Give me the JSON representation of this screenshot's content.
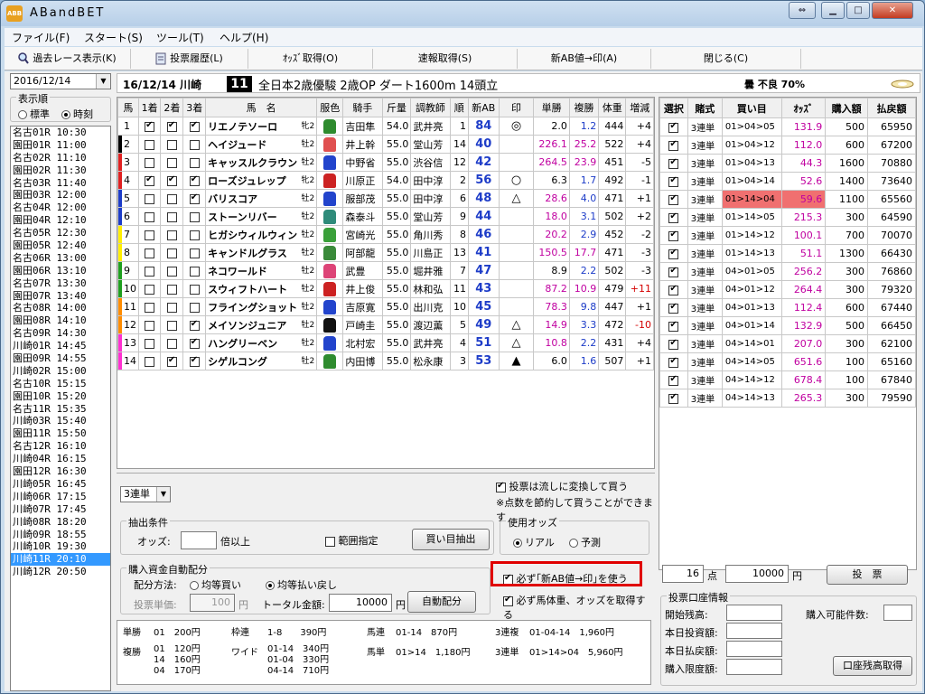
{
  "app": {
    "title": "ABandBET",
    "icon": "abb-app-icon"
  },
  "window_controls": [
    "restore-down-icon",
    "minimize-icon",
    "maximize-icon",
    "close-icon"
  ],
  "menu": [
    {
      "label": "ファイル(F)"
    },
    {
      "label": "スタート(S)"
    },
    {
      "label": "ツール(T)"
    },
    {
      "label": "ヘルプ(H)"
    }
  ],
  "toolbar": [
    {
      "label": "過去レース表示(K)",
      "icon": "search-icon"
    },
    {
      "label": "投票履歴(L)",
      "icon": "document-icon"
    },
    {
      "label": "ｵｯｽﾞ取得(O)"
    },
    {
      "label": "速報取得(S)"
    },
    {
      "label": "新AB値→印(A)"
    },
    {
      "label": "閉じる(C)"
    }
  ],
  "left": {
    "date": "2016/12/14",
    "sort_label": "表示順",
    "sort_options": [
      "標準",
      "時刻"
    ],
    "sort_selected": "時刻",
    "races": [
      "名古01R 10:30",
      "園田01R 11:00",
      "名古02R 11:10",
      "園田02R 11:30",
      "名古03R 11:40",
      "園田03R 12:00",
      "名古04R 12:00",
      "園田04R 12:10",
      "名古05R 12:30",
      "園田05R 12:40",
      "名古06R 13:00",
      "園田06R 13:10",
      "名古07R 13:30",
      "園田07R 13:40",
      "名古08R 14:00",
      "園田08R 14:10",
      "名古09R 14:30",
      "川崎01R 14:45",
      "園田09R 14:55",
      "川崎02R 15:00",
      "名古10R 15:15",
      "園田10R 15:20",
      "名古11R 15:35",
      "川崎03R 15:40",
      "園田11R 15:50",
      "名古12R 16:10",
      "川崎04R 16:15",
      "園田12R 16:30",
      "川崎05R 16:45",
      "川崎06R 17:15",
      "川崎07R 17:45",
      "川崎08R 18:20",
      "川崎09R 18:55",
      "川崎10R 19:30",
      "川崎11R 20:10",
      "川崎12R 20:50"
    ],
    "selected_race": "川崎11R 20:10"
  },
  "race_header": {
    "date_place": "16/12/14 川崎",
    "race_no": "11",
    "race_info": "全日本2歳優駿 2歳OP ダート1600m 14頭立",
    "weather": "曇 不良 70%",
    "weather_icon": "cloud-icon"
  },
  "table_headers": [
    "馬",
    "1着",
    "2着",
    "3着",
    "馬　名",
    "服色",
    "騎手",
    "斤量",
    "調教師",
    "順",
    "新AB",
    "印",
    "単勝",
    "複勝",
    "体重",
    "増減"
  ],
  "horses": [
    {
      "no": "1",
      "c1": true,
      "c2": true,
      "c3": true,
      "name": "リエノテソーロ",
      "sex": "牝2",
      "silk": "#2e8b2e",
      "jockey": "吉田隼",
      "weight": "54.0",
      "trainer": "武井亮",
      "rank": "1",
      "ab": "84",
      "mark": "◎",
      "win": "2.0",
      "place": "1.2",
      "body": "444",
      "diff": "+4",
      "frame": "#ffffff"
    },
    {
      "no": "2",
      "c1": false,
      "c2": false,
      "c3": false,
      "name": "ヘイジュード",
      "sex": "牡2",
      "silk": "#e05050",
      "jockey": "井上幹",
      "weight": "55.0",
      "trainer": "堂山芳",
      "rank": "14",
      "ab": "40",
      "mark": "",
      "win": "226.1",
      "place": "25.2",
      "body": "522",
      "diff": "+4",
      "frame": "#000000"
    },
    {
      "no": "3",
      "c1": false,
      "c2": false,
      "c3": false,
      "name": "キャッスルクラウン",
      "sex": "牡2",
      "silk": "#2244cc",
      "jockey": "中野省",
      "weight": "55.0",
      "trainer": "渋谷信",
      "rank": "12",
      "ab": "42",
      "mark": "",
      "win": "264.5",
      "place": "23.9",
      "body": "451",
      "diff": "-5",
      "frame": "#e02020"
    },
    {
      "no": "4",
      "c1": true,
      "c2": true,
      "c3": true,
      "name": "ローズジュレップ",
      "sex": "牝2",
      "silk": "#cc2222",
      "jockey": "川原正",
      "weight": "54.0",
      "trainer": "田中淳",
      "rank": "2",
      "ab": "56",
      "mark": "○",
      "win": "6.3",
      "place": "1.7",
      "body": "492",
      "diff": "-1",
      "frame": "#e02020"
    },
    {
      "no": "5",
      "c1": false,
      "c2": false,
      "c3": true,
      "name": "バリスコア",
      "sex": "牡2",
      "silk": "#2244cc",
      "jockey": "服部茂",
      "weight": "55.0",
      "trainer": "田中淳",
      "rank": "6",
      "ab": "48",
      "mark": "△",
      "win": "28.6",
      "place": "4.0",
      "body": "471",
      "diff": "+1",
      "frame": "#1d3cc8"
    },
    {
      "no": "6",
      "c1": false,
      "c2": false,
      "c3": false,
      "name": "ストーンリバー",
      "sex": "牡2",
      "silk": "#2e8b7a",
      "jockey": "森泰斗",
      "weight": "55.0",
      "trainer": "堂山芳",
      "rank": "9",
      "ab": "44",
      "mark": "",
      "win": "18.0",
      "place": "3.1",
      "body": "502",
      "diff": "+2",
      "frame": "#1d3cc8"
    },
    {
      "no": "7",
      "c1": false,
      "c2": false,
      "c3": false,
      "name": "ヒガシウィルウィン",
      "sex": "牡2",
      "silk": "#3aa03a",
      "jockey": "宮崎光",
      "weight": "55.0",
      "trainer": "角川秀",
      "rank": "8",
      "ab": "46",
      "mark": "",
      "win": "20.2",
      "place": "2.9",
      "body": "452",
      "diff": "-2",
      "frame": "#ffee00"
    },
    {
      "no": "8",
      "c1": false,
      "c2": false,
      "c3": false,
      "name": "キャンドルグラス",
      "sex": "牡2",
      "silk": "#3a8a3a",
      "jockey": "阿部龍",
      "weight": "55.0",
      "trainer": "川島正",
      "rank": "13",
      "ab": "41",
      "mark": "",
      "win": "150.5",
      "place": "17.7",
      "body": "471",
      "diff": "-3",
      "frame": "#ffee00"
    },
    {
      "no": "9",
      "c1": false,
      "c2": false,
      "c3": false,
      "name": "ネコワールド",
      "sex": "牡2",
      "silk": "#dd4477",
      "jockey": "武豊",
      "weight": "55.0",
      "trainer": "堀井雅",
      "rank": "7",
      "ab": "47",
      "mark": "",
      "win": "8.9",
      "place": "2.2",
      "body": "502",
      "diff": "-3",
      "frame": "#1fa01f"
    },
    {
      "no": "10",
      "c1": false,
      "c2": false,
      "c3": false,
      "name": "スウィフトハート",
      "sex": "牡2",
      "silk": "#cc2222",
      "jockey": "井上俊",
      "weight": "55.0",
      "trainer": "林和弘",
      "rank": "11",
      "ab": "43",
      "mark": "",
      "win": "87.2",
      "place": "10.9",
      "body": "479",
      "diff": "+11",
      "frame": "#1fa01f"
    },
    {
      "no": "11",
      "c1": false,
      "c2": false,
      "c3": false,
      "name": "フライングショット",
      "sex": "牡2",
      "silk": "#2244cc",
      "jockey": "吉原寛",
      "weight": "55.0",
      "trainer": "出川克",
      "rank": "10",
      "ab": "45",
      "mark": "",
      "win": "78.3",
      "place": "9.8",
      "body": "447",
      "diff": "+1",
      "frame": "#ff8c00"
    },
    {
      "no": "12",
      "c1": false,
      "c2": false,
      "c3": true,
      "name": "メイソンジュニア",
      "sex": "牡2",
      "silk": "#111111",
      "jockey": "戸崎圭",
      "weight": "55.0",
      "trainer": "渡辺薫",
      "rank": "5",
      "ab": "49",
      "mark": "△",
      "win": "14.9",
      "place": "3.3",
      "body": "472",
      "diff": "-10",
      "frame": "#ff8c00"
    },
    {
      "no": "13",
      "c1": false,
      "c2": false,
      "c3": true,
      "name": "ハングリーベン",
      "sex": "牡2",
      "silk": "#2244cc",
      "jockey": "北村宏",
      "weight": "55.0",
      "trainer": "武井亮",
      "rank": "4",
      "ab": "51",
      "mark": "△",
      "win": "10.8",
      "place": "2.2",
      "body": "431",
      "diff": "+4",
      "frame": "#ff30d0"
    },
    {
      "no": "14",
      "c1": false,
      "c2": true,
      "c3": true,
      "name": "シゲルコング",
      "sex": "牡2",
      "silk": "#2e8b2e",
      "jockey": "内田博",
      "weight": "55.0",
      "trainer": "松永康",
      "rank": "3",
      "ab": "53",
      "mark": "▲",
      "win": "6.0",
      "place": "1.6",
      "body": "507",
      "diff": "+1",
      "frame": "#ff30d0"
    }
  ],
  "bottom": {
    "bet_type": "3連単",
    "convert_check": "投票は流しに変換して買う",
    "convert_note": "※点数を節約して買うことができます",
    "extract": {
      "title": "抽出条件",
      "odds_label": "オッズ:",
      "odds_suffix": "倍以上",
      "range_label": "範囲指定",
      "button": "買い目抽出"
    },
    "odds_use": {
      "title": "使用オッズ",
      "options": [
        "リアル",
        "予測"
      ],
      "selected": "リアル"
    },
    "auto": {
      "title": "購入資金自動配分",
      "method_label": "配分方法:",
      "options": [
        "均等買い",
        "均等払い戻し"
      ],
      "selected": "均等払い戻し",
      "unit_label": "投票単価:",
      "unit_value": "100",
      "unit_suffix": "円",
      "total_label": "トータル金額:",
      "total_value": "10000",
      "total_suffix": "円",
      "button": "自動配分"
    },
    "opt1": "必ず｢新AB値→印｣を使う",
    "opt2": "必ず馬体重、オッズを取得する",
    "results": [
      {
        "label": "単勝",
        "value": "01　200円"
      },
      {
        "label": "複勝",
        "value": "01　120円\n14　160円\n04　170円"
      },
      {
        "label": "枠連",
        "value": "1-8　　390円"
      },
      {
        "label": "ワイド",
        "value": "01-14　340円\n01-04　330円\n04-14　710円"
      },
      {
        "label": "馬連",
        "value": "01-14　870円"
      },
      {
        "label": "馬単",
        "value": "01>14　1,180円"
      },
      {
        "label": "3連複",
        "value": "01-04-14　1,960円"
      },
      {
        "label": "3連単",
        "value": "01>14>04　5,960円"
      }
    ]
  },
  "bets": {
    "headers": [
      "選択",
      "賭式",
      "買い目",
      "ｵｯｽﾞ",
      "購入額",
      "払戻額"
    ],
    "rows": [
      {
        "type": "3連単",
        "combo": "01>04>05",
        "odds": "131.9",
        "amount": "500",
        "payout": "65950"
      },
      {
        "type": "3連単",
        "combo": "01>04>12",
        "odds": "112.0",
        "amount": "600",
        "payout": "67200"
      },
      {
        "type": "3連単",
        "combo": "01>04>13",
        "odds": "44.3",
        "amount": "1600",
        "payout": "70880"
      },
      {
        "type": "3連単",
        "combo": "01>04>14",
        "odds": "52.6",
        "amount": "1400",
        "payout": "73640"
      },
      {
        "type": "3連単",
        "combo": "01>14>04",
        "odds": "59.6",
        "amount": "1100",
        "payout": "65560",
        "highlight": true
      },
      {
        "type": "3連単",
        "combo": "01>14>05",
        "odds": "215.3",
        "amount": "300",
        "payout": "64590"
      },
      {
        "type": "3連単",
        "combo": "01>14>12",
        "odds": "100.1",
        "amount": "700",
        "payout": "70070"
      },
      {
        "type": "3連単",
        "combo": "01>14>13",
        "odds": "51.1",
        "amount": "1300",
        "payout": "66430"
      },
      {
        "type": "3連単",
        "combo": "04>01>05",
        "odds": "256.2",
        "amount": "300",
        "payout": "76860"
      },
      {
        "type": "3連単",
        "combo": "04>01>12",
        "odds": "264.4",
        "amount": "300",
        "payout": "79320"
      },
      {
        "type": "3連単",
        "combo": "04>01>13",
        "odds": "112.4",
        "amount": "600",
        "payout": "67440"
      },
      {
        "type": "3連単",
        "combo": "04>01>14",
        "odds": "132.9",
        "amount": "500",
        "payout": "66450"
      },
      {
        "type": "3連単",
        "combo": "04>14>01",
        "odds": "207.0",
        "amount": "300",
        "payout": "62100"
      },
      {
        "type": "3連単",
        "combo": "04>14>05",
        "odds": "651.6",
        "amount": "100",
        "payout": "65160"
      },
      {
        "type": "3連単",
        "combo": "04>14>12",
        "odds": "678.4",
        "amount": "100",
        "payout": "67840"
      },
      {
        "type": "3連単",
        "combo": "04>14>13",
        "odds": "265.3",
        "amount": "300",
        "payout": "79590"
      }
    ],
    "points": "16",
    "points_suffix": "点",
    "total": "10000",
    "total_suffix": "円",
    "vote_button": "投　票"
  },
  "account": {
    "title": "投票口座情報",
    "labels": [
      "開始残高:",
      "本日投資額:",
      "本日払戻額:",
      "購入限度額:"
    ],
    "possible_label": "購入可能件数:",
    "button": "口座残高取得"
  }
}
